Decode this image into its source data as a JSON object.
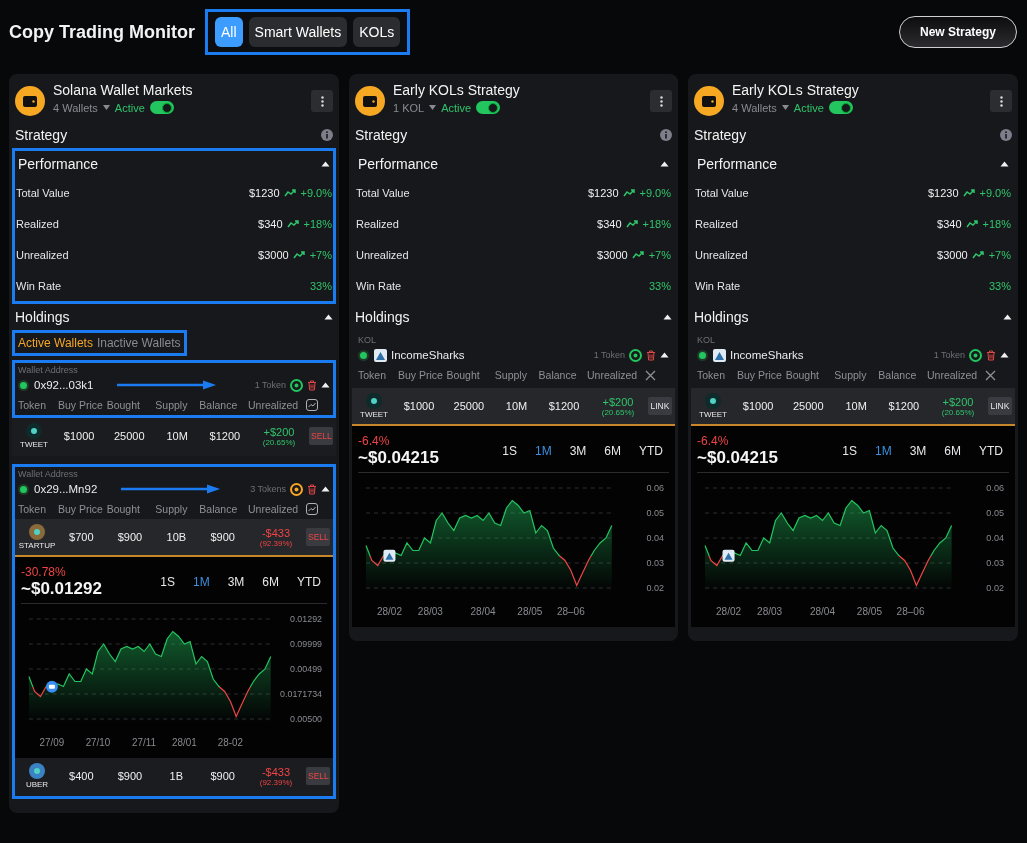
{
  "header": {
    "title": "Copy Trading Monitor",
    "highlighted": true,
    "filters": [
      {
        "label": "All",
        "selected": true
      },
      {
        "label": "Smart Wallets",
        "selected": false
      },
      {
        "label": "KOLs",
        "selected": false
      }
    ],
    "new_button": "New Strategy"
  },
  "strategies": [
    {
      "name": "Solana Wallet Markets",
      "count": "4 Wallets",
      "status": "Active",
      "active": true,
      "section_title": "Strategy",
      "performance": {
        "title": "Performance",
        "expanded": true,
        "highlighted": true,
        "rows": [
          {
            "label": "Total Value",
            "value": "$1230",
            "change": "+9.0%",
            "rising": true
          },
          {
            "label": "Realized",
            "value": "$340",
            "change": "+18%",
            "rising": true
          },
          {
            "label": "Unrealized",
            "value": "$3000",
            "change": "+7%",
            "rising": true
          },
          {
            "label": "Win Rate",
            "change": "33%"
          }
        ]
      },
      "holdings": {
        "title": "Holdings",
        "expanded": true,
        "tabs_highlighted": true,
        "tabs": [
          {
            "label": "Active Wallets",
            "selected": true
          },
          {
            "label": "Inactive Wallets",
            "selected": false
          }
        ],
        "groups": [
          {
            "kind": "wallet",
            "caption": "Wallet Address",
            "name": "0x92...03k1",
            "tokens": "1 Token",
            "color": "#22c55e",
            "highlighted": true,
            "arrow": true,
            "expanded": true,
            "columns": [
              "Token",
              "Buy Price",
              "Bought",
              "Supply",
              "Balance",
              "Unrealized"
            ],
            "positions": [
              {
                "symbol": "TWEET",
                "color": "#0f2a2a",
                "buy_price": "$1000",
                "bought": "25000",
                "supply": "10M",
                "balance": "$1200",
                "pnl": "+$200",
                "pnl_pct": "(20.65%)",
                "negative": false,
                "action": "SELL",
                "kind": "sell",
                "selected": false,
                "highlighted": false
              }
            ]
          },
          {
            "kind": "wallet",
            "caption": "Wallet Address",
            "name": "0x29...Mn92",
            "tokens": "3 Tokens",
            "color": "#f5a623",
            "highlighted": true,
            "arrow": true,
            "expanded": true,
            "columns": [
              "Token",
              "Buy Price",
              "Bought",
              "Supply",
              "Balance",
              "Unrealized"
            ],
            "positions": [
              {
                "symbol": "STARTUP",
                "color": "#8a6a3a",
                "buy_price": "$700",
                "bought": "$900",
                "supply": "10B",
                "balance": "$900",
                "pnl": "-$433",
                "pnl_pct": "(92.39%)",
                "negative": true,
                "action": "SELL",
                "kind": "sell",
                "selected": true,
                "highlighted": true,
                "chart": {
                  "change": "-30.78%",
                  "negative": true,
                  "price": "~$0.01292",
                  "ranges": [
                    {
                      "label": "1S",
                      "selected": false
                    },
                    {
                      "label": "1M",
                      "selected": true
                    },
                    {
                      "label": "3M",
                      "selected": false
                    },
                    {
                      "label": "6M",
                      "selected": false
                    },
                    {
                      "label": "YTD",
                      "selected": false
                    }
                  ],
                  "axis": {
                    "y_labels": [
                      "0.01292",
                      "0.09999",
                      "0.00499",
                      "0.0171734",
                      "0.00500"
                    ],
                    "x_labels": [
                      "27/09",
                      "27/10",
                      "27/11",
                      "28/01",
                      "28-02"
                    ]
                  }
                }
              },
              {
                "symbol": "UBER",
                "color": "#3b82c4",
                "buy_price": "$400",
                "bought": "$900",
                "supply": "1B",
                "balance": "$900",
                "pnl": "-$433",
                "pnl_pct": "(92.39%)",
                "negative": true,
                "action": "SELL",
                "kind": "sell",
                "selected": false,
                "highlighted": true
              }
            ]
          }
        ]
      }
    },
    {
      "name": "Early KOLs Strategy",
      "count": "1 KOL",
      "status": "Active",
      "active": true,
      "section_title": "Strategy",
      "performance": {
        "title": "Performance",
        "expanded": true,
        "highlighted": false,
        "rows": [
          {
            "label": "Total Value",
            "value": "$1230",
            "change": "+9.0%",
            "rising": true
          },
          {
            "label": "Realized",
            "value": "$340",
            "change": "+18%",
            "rising": true
          },
          {
            "label": "Unrealized",
            "value": "$3000",
            "change": "+7%",
            "rising": true
          },
          {
            "label": "Win Rate",
            "change": "33%"
          }
        ]
      },
      "holdings": {
        "title": "Holdings",
        "expanded": true,
        "groups": [
          {
            "kind": "kol",
            "caption": "KOL",
            "name": "IncomeSharks",
            "tokens": "1 Token",
            "color": "#22c55e",
            "highlighted": false,
            "expanded": true,
            "columns": [
              "Token",
              "Buy Price",
              "Bought",
              "Supply",
              "Balance",
              "Unrealized"
            ],
            "positions": [
              {
                "symbol": "TWEET",
                "color": "#0f2a2a",
                "buy_price": "$1000",
                "bought": "25000",
                "supply": "10M",
                "balance": "$1200",
                "pnl": "+$200",
                "pnl_pct": "(20.65%)",
                "negative": false,
                "action": "LINK",
                "kind": "link",
                "selected": true,
                "highlighted": false,
                "chart": {
                  "change": "-6.4%",
                  "negative": true,
                  "price": "~$0.04215",
                  "ranges": [
                    {
                      "label": "1S",
                      "selected": false
                    },
                    {
                      "label": "1M",
                      "selected": true
                    },
                    {
                      "label": "3M",
                      "selected": false
                    },
                    {
                      "label": "6M",
                      "selected": false
                    },
                    {
                      "label": "YTD",
                      "selected": false
                    }
                  ],
                  "chart_data": {
                    "type": "area",
                    "grid": true,
                    "ylim": [
                      0.02,
                      0.06
                    ],
                    "yticks": [
                      0.06,
                      0.05,
                      0.04,
                      0.03,
                      0.02
                    ],
                    "categories": [
                      null,
                      null,
                      null,
                      null,
                      "28/02",
                      null,
                      null,
                      null,
                      null,
                      null,
                      null,
                      "28/03",
                      null,
                      null,
                      null,
                      null,
                      null,
                      null,
                      null,
                      null,
                      "28/04",
                      null,
                      null,
                      null,
                      null,
                      null,
                      null,
                      null,
                      "28/05",
                      null,
                      null,
                      null,
                      null,
                      null,
                      null,
                      "28–06",
                      null,
                      null,
                      null,
                      null,
                      null,
                      null,
                      null
                    ],
                    "series": [
                      {
                        "color": "#22c55e",
                        "values": [
                          0.037,
                          0.031,
                          0.029,
                          0.033,
                          0.033,
                          0.034,
                          0.033,
                          0.038,
                          0.035,
                          0.035,
                          0.04,
                          0.038,
                          0.047,
                          0.05,
                          0.046,
                          0.043,
                          0.048,
                          0.049,
                          0.048,
                          0.049,
                          0.047,
                          0.05,
                          0.046,
                          0.045,
                          0.052,
                          0.055,
                          0.053,
                          0.05,
                          0.051,
                          0.042,
                          0.045,
                          0.043,
                          0.036,
                          0.033,
                          0.031,
                          0.027,
                          0.021,
                          0.026,
                          0.031,
                          0.035,
                          0.038,
                          0.04,
                          0.045
                        ]
                      }
                    ]
                  }
                }
              }
            ]
          }
        ]
      }
    },
    {
      "name": "Early KOLs Strategy",
      "count": "4 Wallets",
      "status": "Active",
      "active": true,
      "section_title": "Strategy",
      "performance": {
        "title": "Performance",
        "expanded": true,
        "highlighted": false,
        "rows": [
          {
            "label": "Total Value",
            "value": "$1230",
            "change": "+9.0%",
            "rising": true
          },
          {
            "label": "Realized",
            "value": "$340",
            "change": "+18%",
            "rising": true
          },
          {
            "label": "Unrealized",
            "value": "$3000",
            "change": "+7%",
            "rising": true
          },
          {
            "label": "Win Rate",
            "change": "33%"
          }
        ]
      },
      "holdings": {
        "title": "Holdings",
        "expanded": true,
        "groups": [
          {
            "kind": "kol",
            "caption": "KOL",
            "name": "IncomeSharks",
            "tokens": "1 Token",
            "color": "#22c55e",
            "highlighted": false,
            "expanded": true,
            "columns": [
              "Token",
              "Buy Price",
              "Bought",
              "Supply",
              "Balance",
              "Unrealized"
            ],
            "positions": [
              {
                "symbol": "TWEET",
                "color": "#0f2a2a",
                "buy_price": "$1000",
                "bought": "25000",
                "supply": "10M",
                "balance": "$1200",
                "pnl": "+$200",
                "pnl_pct": "(20.65%)",
                "negative": false,
                "action": "LINK",
                "kind": "link",
                "selected": true,
                "highlighted": false,
                "chart": {
                  "change": "-6.4%",
                  "negative": true,
                  "price": "~$0.04215",
                  "ranges": [
                    {
                      "label": "1S",
                      "selected": false
                    },
                    {
                      "label": "1M",
                      "selected": true
                    },
                    {
                      "label": "3M",
                      "selected": false
                    },
                    {
                      "label": "6M",
                      "selected": false
                    },
                    {
                      "label": "YTD",
                      "selected": false
                    }
                  ],
                  "chart_data": {
                    "type": "area",
                    "grid": true,
                    "ylim": [
                      0.02,
                      0.06
                    ],
                    "yticks": [
                      0.06,
                      0.05,
                      0.04,
                      0.03,
                      0.02
                    ],
                    "categories": [
                      null,
                      null,
                      null,
                      null,
                      "28/02",
                      null,
                      null,
                      null,
                      null,
                      null,
                      null,
                      "28/03",
                      null,
                      null,
                      null,
                      null,
                      null,
                      null,
                      null,
                      null,
                      "28/04",
                      null,
                      null,
                      null,
                      null,
                      null,
                      null,
                      null,
                      "28/05",
                      null,
                      null,
                      null,
                      null,
                      null,
                      null,
                      "28–06",
                      null,
                      null,
                      null,
                      null,
                      null,
                      null,
                      null
                    ],
                    "series": [
                      {
                        "color": "#22c55e",
                        "values": [
                          0.037,
                          0.031,
                          0.029,
                          0.033,
                          0.033,
                          0.034,
                          0.033,
                          0.038,
                          0.035,
                          0.035,
                          0.04,
                          0.038,
                          0.047,
                          0.05,
                          0.046,
                          0.043,
                          0.048,
                          0.049,
                          0.048,
                          0.049,
                          0.047,
                          0.05,
                          0.046,
                          0.045,
                          0.052,
                          0.055,
                          0.053,
                          0.05,
                          0.051,
                          0.042,
                          0.045,
                          0.043,
                          0.036,
                          0.033,
                          0.031,
                          0.027,
                          0.021,
                          0.026,
                          0.031,
                          0.035,
                          0.038,
                          0.04,
                          0.045
                        ]
                      }
                    ]
                  }
                }
              }
            ]
          }
        ]
      }
    }
  ]
}
